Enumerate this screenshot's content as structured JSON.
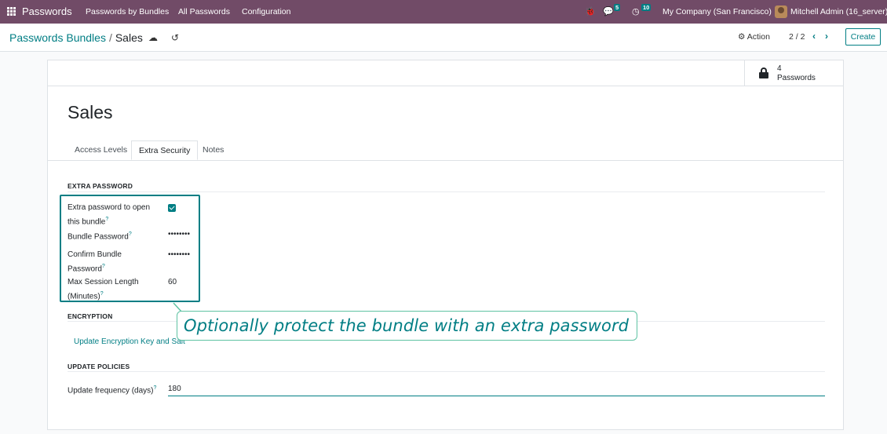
{
  "navbar": {
    "brand": "Passwords",
    "menu": [
      "Passwords by Bundles",
      "All Passwords",
      "Configuration"
    ],
    "messages_count": "5",
    "activities_count": "10",
    "company": "My Company (San Francisco)",
    "user": "Mitchell Admin (16_server)"
  },
  "control_panel": {
    "breadcrumb_parent": "Passwords Bundles",
    "breadcrumb_separator": "/",
    "breadcrumb_current": "Sales",
    "action_label": "Action",
    "pager_value": "2 / 2",
    "create_label": "Create"
  },
  "record": {
    "smart_button_value": "4",
    "smart_button_label": "Passwords",
    "title": "Sales",
    "tabs": [
      "Access Levels",
      "Extra Security",
      "Notes"
    ],
    "active_tab": "Extra Security"
  },
  "sections": {
    "extra_password": {
      "title": "EXTRA PASSWORD",
      "fields": [
        {
          "label": "Extra password to open this bundle",
          "value": "checked"
        },
        {
          "label": "Bundle Password",
          "value": "••••••••"
        },
        {
          "label": "Confirm Bundle Password",
          "value": "••••••••"
        },
        {
          "label": "Max Session Length (Minutes)",
          "value": "60"
        }
      ]
    },
    "encryption": {
      "title": "ENCRYPTION",
      "button": "Update Encryption Key and Salt"
    },
    "update_policies": {
      "title": "UPDATE POLICIES",
      "fields": [
        {
          "label": "Update frequency (days)",
          "value": "180"
        }
      ]
    }
  },
  "help_mark": "?",
  "tooltip": {
    "text": "Optionally protect the bundle with an extra password"
  },
  "colors": {
    "navbar": "#714b67",
    "accent": "#017e84",
    "tooltip_border": "#5fc3a3"
  }
}
